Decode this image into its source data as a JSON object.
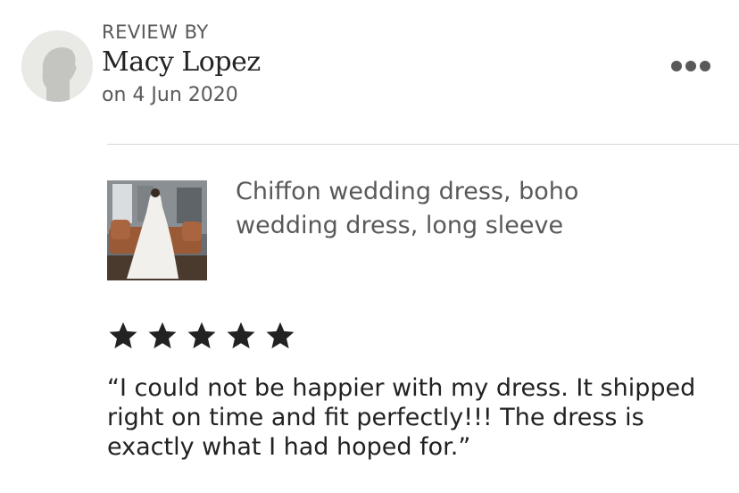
{
  "review": {
    "heading": "REVIEW BY",
    "reviewer_name": "Macy Lopez",
    "date": "on 4 Jun 2020",
    "rating": 5,
    "max_rating": 5,
    "text": "“I could not be happier with my dress. It shipped right on time and fit perfectly!!! The dress is exactly what I had hoped for.”"
  },
  "item": {
    "title": "Chiffon wedding dress, boho wedding dress, long sleeve"
  },
  "icons": {
    "avatar": "default-user-silhouette-icon",
    "more": "more-options-icon",
    "star": "star-icon"
  },
  "colors": {
    "text_primary": "#222222",
    "text_secondary": "#595959",
    "divider": "#d6d6d6",
    "star": "#222222"
  }
}
